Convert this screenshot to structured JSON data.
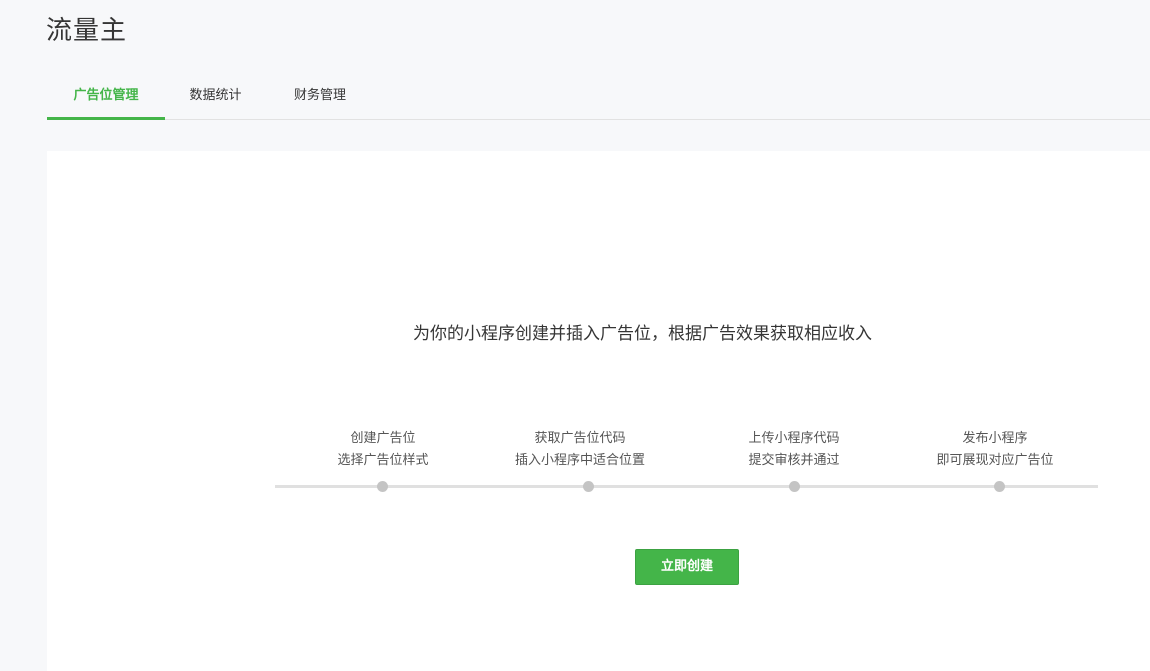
{
  "page": {
    "title": "流量主"
  },
  "tabs": [
    {
      "label": "广告位管理",
      "active": true
    },
    {
      "label": "数据统计",
      "active": false
    },
    {
      "label": "财务管理",
      "active": false
    }
  ],
  "main": {
    "intro": "为你的小程序创建并插入广告位，根据广告效果获取相应收入",
    "steps": [
      {
        "line1": "创建广告位",
        "line2": "选择广告位样式"
      },
      {
        "line1": "获取广告位代码",
        "line2": "插入小程序中适合位置"
      },
      {
        "line1": "上传小程序代码",
        "line2": "提交审核并通过"
      },
      {
        "line1": "发布小程序",
        "line2": "即可展现对应广告位"
      }
    ],
    "create_button": "立即创建"
  },
  "colors": {
    "accent": "#44b549",
    "background": "#f7f8fa",
    "card": "#ffffff",
    "dot": "#c4c4c4"
  }
}
